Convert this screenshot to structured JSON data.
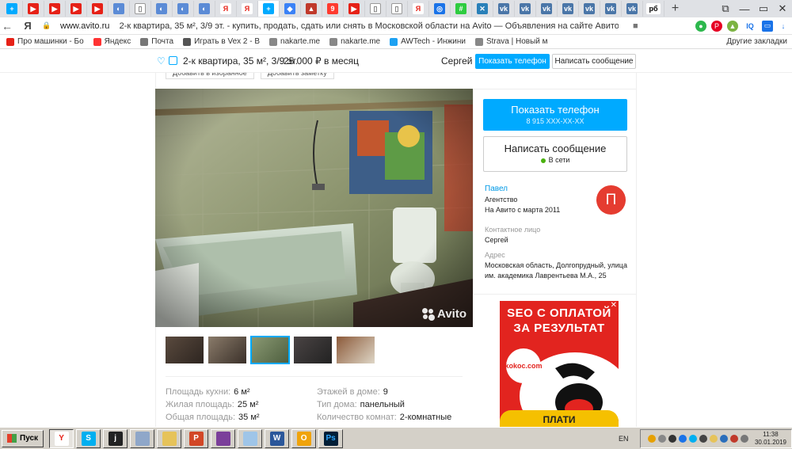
{
  "browser": {
    "tab_icons": [
      "avito-icon",
      "youtube-icon",
      "youtube-icon",
      "youtube-icon",
      "youtube-icon",
      "web-icon",
      "doc-icon",
      "web-icon",
      "web-icon",
      "web-icon",
      "yandex-icon",
      "yandex-icon",
      "avito-icon",
      "map-icon",
      "red-icon",
      "map-pin-icon",
      "youtube-icon",
      "doc-icon",
      "doc-icon",
      "yandex-icon",
      "target-icon",
      "plus-icon",
      "close-x-icon",
      "vk-icon",
      "vk-icon",
      "vk-icon",
      "vk-icon",
      "vk-icon",
      "vk-icon",
      "vk-icon",
      "rb-icon"
    ],
    "rb_label": "рб",
    "new_tab": "+",
    "back": "←",
    "yandex_logo": "Я",
    "lock": "🔒",
    "url_domain": "www.avito.ru",
    "url_title": "2-к квартира, 35 м², 3/9 эт. - купить, продать, сдать или снять в Московской области на Avito — Объявления на сайте Авито",
    "star": "★"
  },
  "bookmarks": [
    {
      "label": "Про машинки - Бо",
      "color": "#e62117"
    },
    {
      "label": "Яндекс",
      "color": "#ff3333"
    },
    {
      "label": "Почта",
      "color": "#777777"
    },
    {
      "label": "Играть в Vex 2 - В",
      "color": "#555555"
    },
    {
      "label": "nakarte.me",
      "color": "#888888"
    },
    {
      "label": "nakarte.me",
      "color": "#888888"
    },
    {
      "label": "AWTech - Инжини",
      "color": "#1da1f2"
    },
    {
      "label": "Strava | Новый м",
      "color": "#888888"
    }
  ],
  "bookmarks_other": "Другие закладки",
  "sticky": {
    "title": "2-к квартира, 35 м², 3/9 эт.",
    "price": "25 000  ₽ в месяц",
    "user": "Сергей",
    "show_phone": "Показать телефон",
    "write_message": "Написать сообщение"
  },
  "chips": [
    "Добавить в избранное",
    "Добавить заметку"
  ],
  "photo": {
    "watermark": "Avito"
  },
  "thumbnails": [
    {
      "selected": false,
      "colors": [
        "#5a4a3e",
        "#2d2520"
      ]
    },
    {
      "selected": false,
      "colors": [
        "#8a7b6a",
        "#3a3029"
      ]
    },
    {
      "selected": true,
      "colors": [
        "#8b9a74",
        "#4d5e3e"
      ]
    },
    {
      "selected": false,
      "colors": [
        "#4a4444",
        "#222"
      ]
    },
    {
      "selected": false,
      "colors": [
        "#8c5a3a",
        "#ded6c6"
      ]
    }
  ],
  "params": {
    "left": [
      {
        "label": "Площадь кухни:",
        "value": "6 м²"
      },
      {
        "label": "Жилая площадь:",
        "value": "25 м²"
      },
      {
        "label": "Общая площадь:",
        "value": "35 м²"
      }
    ],
    "right": [
      {
        "label": "Этажей в доме:",
        "value": "9"
      },
      {
        "label": "Тип дома:",
        "value": "панельный"
      },
      {
        "label": "Количество комнат:",
        "value": "2-комнатные"
      }
    ]
  },
  "sidebar": {
    "show_phone": "Показать телефон",
    "phone_mask": "8 915 XXX-XX-XX",
    "write_message": "Написать сообщение",
    "online": "В сети",
    "seller_name": "Павел",
    "seller_type": "Агентство",
    "seller_since": "На Авито с марта 2011",
    "avatar_letter": "П",
    "contact_label": "Контактное лицо",
    "contact_value": "Сергей",
    "address_label": "Адрес",
    "address_value": "Московская область, Долгопрудный, улица им. академика Лаврентьева М.А., 25"
  },
  "ad": {
    "close": "✕",
    "title_line1": "SEO С ОПЛАТОЙ",
    "title_line2": "ЗА РЕЗУЛЬТАТ",
    "logo": "kokoc.com",
    "button": "ПЛАТИ"
  },
  "taskbar": {
    "start": "Пуск",
    "apps": [
      {
        "name": "yandex-browser-app",
        "label": "Y",
        "color": "#ffffff",
        "fg": "#e62117",
        "active": true
      },
      {
        "name": "skype-app",
        "label": "S",
        "color": "#00aff0",
        "fg": "#fff",
        "active": false
      },
      {
        "name": "itunes-app",
        "label": "j",
        "color": "#222",
        "fg": "#fff",
        "active": false
      },
      {
        "name": "calculator-app",
        "label": "",
        "color": "#8fa7c9",
        "fg": "#fff",
        "active": false
      },
      {
        "name": "folder-app",
        "label": "",
        "color": "#e6c35a",
        "fg": "#fff",
        "active": false
      },
      {
        "name": "powerpoint-app",
        "label": "P",
        "color": "#d24726",
        "fg": "#fff",
        "active": false
      },
      {
        "name": "winrar-app",
        "label": "",
        "color": "#7b3f9a",
        "fg": "#fff",
        "active": false
      },
      {
        "name": "notes-app",
        "label": "",
        "color": "#9fc5e8",
        "fg": "#fff",
        "active": false
      },
      {
        "name": "word-app",
        "label": "W",
        "color": "#2b579a",
        "fg": "#fff",
        "active": false
      },
      {
        "name": "outlook-app",
        "label": "O",
        "color": "#f0a30a",
        "fg": "#fff",
        "active": false
      },
      {
        "name": "photoshop-app",
        "label": "Ps",
        "color": "#001e36",
        "fg": "#31a8ff",
        "active": false
      }
    ],
    "lang": "EN",
    "time": "11:38",
    "date": "30.01.2019"
  },
  "colors": {
    "accent": "#00aaff",
    "avatar": "#e53c30",
    "online": "#4ab10f",
    "ad_bg": "#e2241f"
  }
}
